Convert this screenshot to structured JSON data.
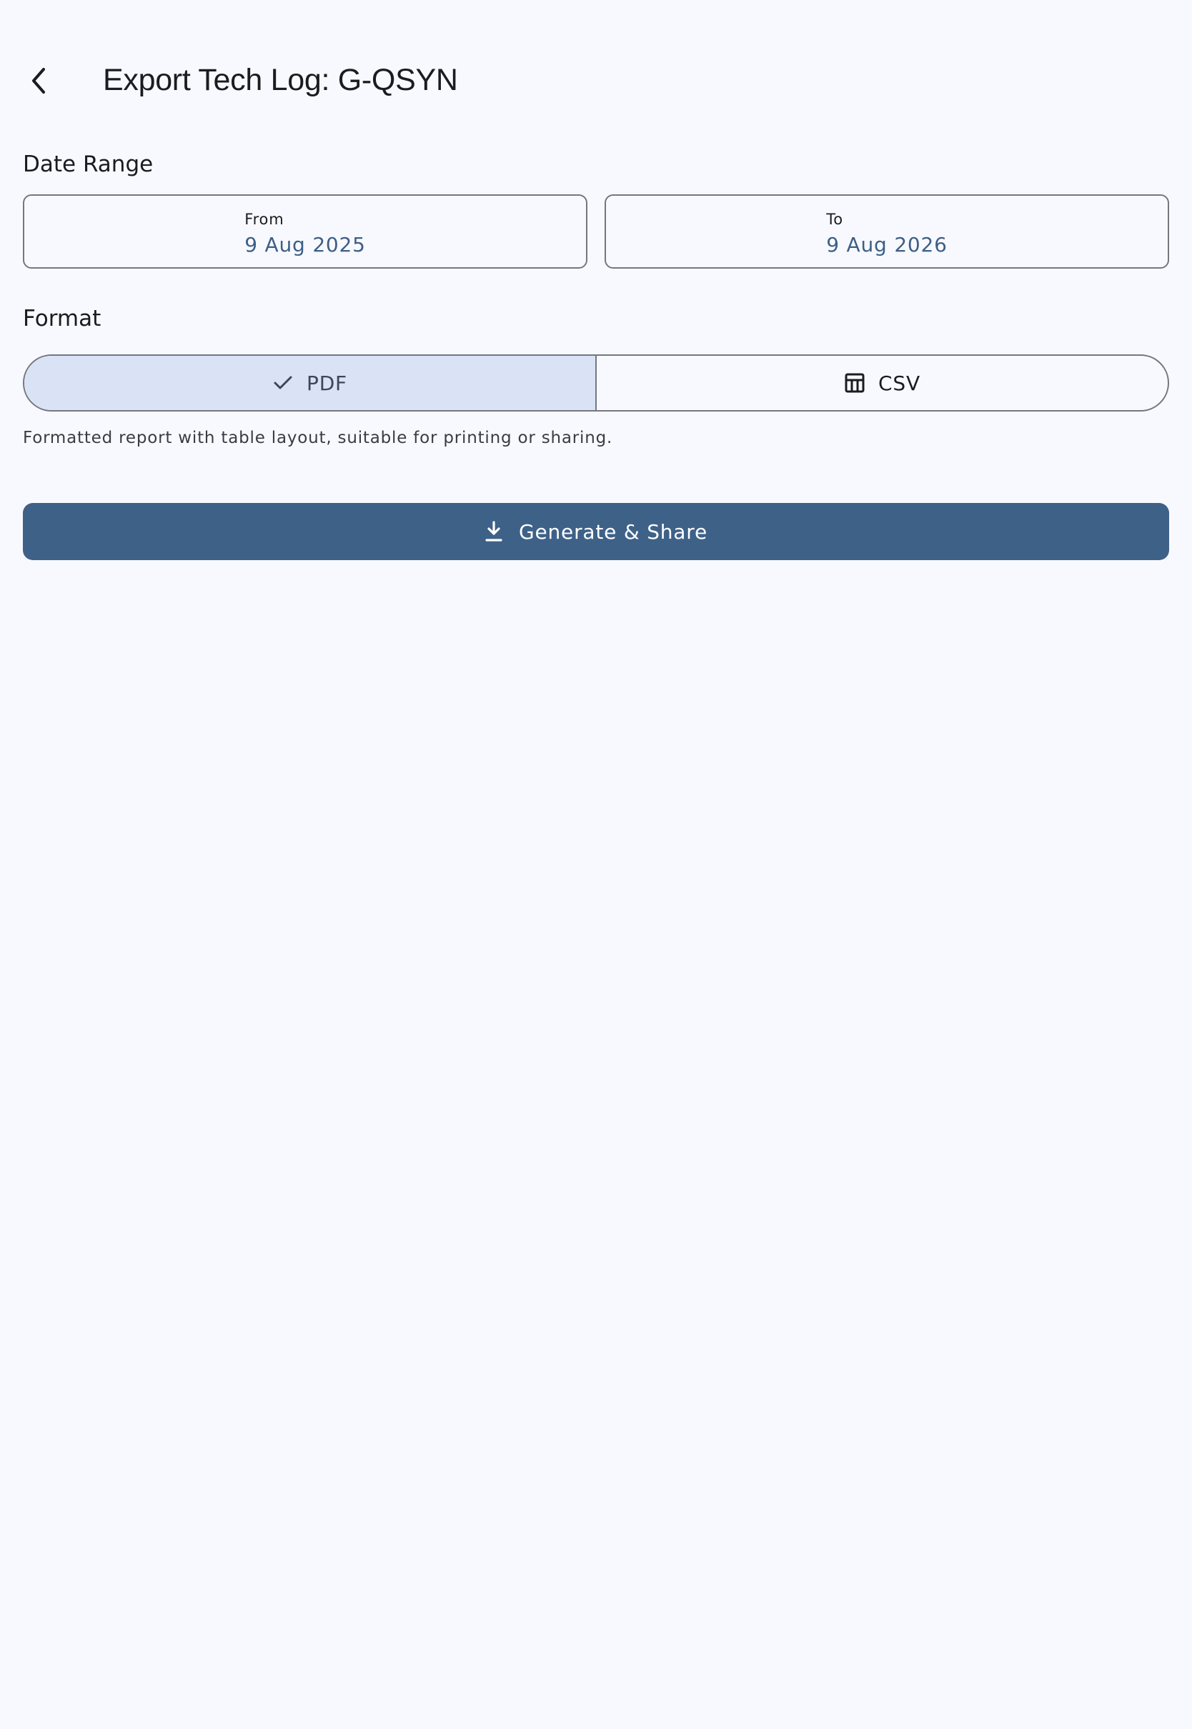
{
  "header": {
    "back_icon": "arrow-back-icon",
    "title": "Export Tech Log: G-QSYN"
  },
  "date_range": {
    "label": "Date Range",
    "from": {
      "caption": "From",
      "value": "9 Aug 2025"
    },
    "to": {
      "caption": "To",
      "value": "9 Aug 2026"
    }
  },
  "format": {
    "label": "Format",
    "options": [
      {
        "label": "PDF",
        "icon": "check-icon",
        "selected": true
      },
      {
        "label": "CSV",
        "icon": "table-icon",
        "selected": false
      }
    ],
    "description": "Formatted report with table layout, suitable for printing or sharing."
  },
  "action": {
    "label": "Generate & Share",
    "icon": "download-icon"
  },
  "colors": {
    "background": "#f8f9fe",
    "primary": "#3e6188",
    "selected_segment": "#d9e3f5",
    "date_value": "#3c5f87",
    "outline": "#74777f"
  }
}
